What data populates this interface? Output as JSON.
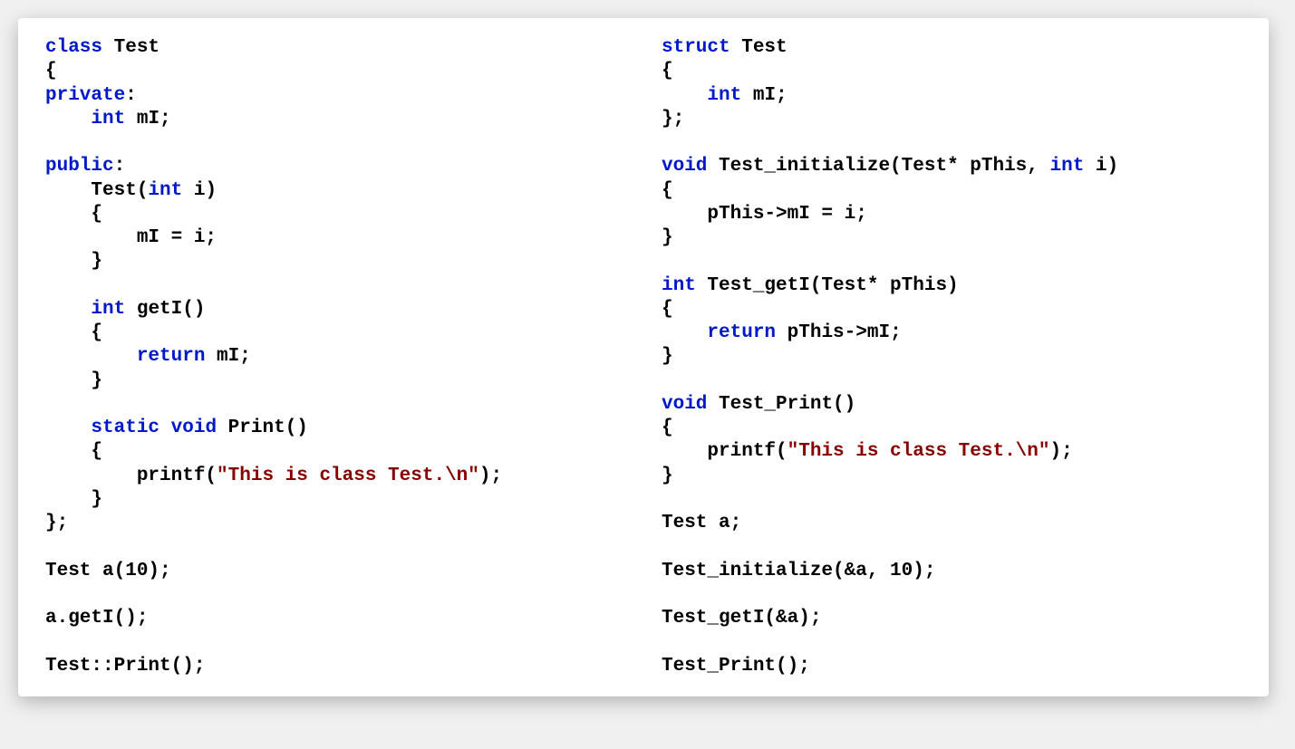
{
  "left": {
    "l1_kw": "class",
    "l1_rest": " Test",
    "l2": "{",
    "l3_kw": "private",
    "l3_rest": ":",
    "l4_pre": "    ",
    "l4_kw": "int",
    "l4_rest": " mI;",
    "blankA": "",
    "l5_kw": "public",
    "l5_rest": ":",
    "l6_pre": "    Test(",
    "l6_kw": "int",
    "l6_rest": " i)",
    "l7": "    {",
    "l8": "        mI = i;",
    "l9": "    }",
    "blankB": "",
    "l10_pre": "    ",
    "l10_kw": "int",
    "l10_rest": " getI()",
    "l11": "    {",
    "l12_pre": "        ",
    "l12_kw": "return",
    "l12_rest": " mI;",
    "l13": "    }",
    "blankC": "",
    "l14_pre": "    ",
    "l14_kw1": "static",
    "l14_sp": " ",
    "l14_kw2": "void",
    "l14_rest": " Print()",
    "l15": "    {",
    "l16_pre": "        printf(",
    "l16_str": "\"This is class Test.\\n\"",
    "l16_rest": ");",
    "l17": "    }",
    "l18": "};",
    "blankD": "",
    "l19": "Test a(10);",
    "blankE": "",
    "l20": "a.getI();",
    "blankF": "",
    "l21": "Test::Print();"
  },
  "right": {
    "r1_kw": "struct",
    "r1_rest": " Test",
    "r2": "{",
    "r3_pre": "    ",
    "r3_kw": "int",
    "r3_rest": " mI;",
    "r4": "};",
    "blankA": "",
    "r5_kw": "void",
    "r5_mid": " Test_initialize(Test* pThis, ",
    "r5_kw2": "int",
    "r5_rest": " i)",
    "r6": "{",
    "r7": "    pThis->mI = i;",
    "r8": "}",
    "blankB": "",
    "r9_kw": "int",
    "r9_rest": " Test_getI(Test* pThis)",
    "r10": "{",
    "r11_pre": "    ",
    "r11_kw": "return",
    "r11_rest": " pThis->mI;",
    "r12": "}",
    "blankC": "",
    "r13_kw": "void",
    "r13_rest": " Test_Print()",
    "r14": "{",
    "r15_pre": "    printf(",
    "r15_str": "\"This is class Test.\\n\"",
    "r15_rest": ");",
    "r16": "}",
    "blankD": "",
    "r17": "Test a;",
    "blankE": "",
    "r18": "Test_initialize(&a, 10);",
    "blankF": "",
    "r19": "Test_getI(&a);",
    "blankG": "",
    "r20": "Test_Print();"
  }
}
